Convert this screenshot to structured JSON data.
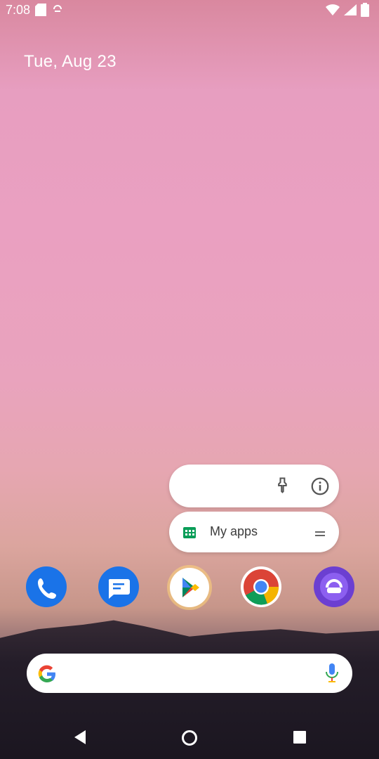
{
  "status_bar": {
    "time": "7:08"
  },
  "home": {
    "date": "Tue, Aug 23"
  },
  "popup": {
    "shortcut_label": "My apps"
  },
  "icons": {
    "pin": "pin-icon",
    "info": "info-icon",
    "myapps": "my-apps-icon",
    "drag": "drag-handle-icon",
    "phone": "phone-icon",
    "messages": "messages-icon",
    "play": "play-store-icon",
    "chrome": "chrome-icon",
    "other": "app-icon",
    "google": "google-g-icon",
    "mic": "mic-icon"
  },
  "colors": {
    "accent_blue": "#1a73e8",
    "play_green": "#01875f"
  }
}
